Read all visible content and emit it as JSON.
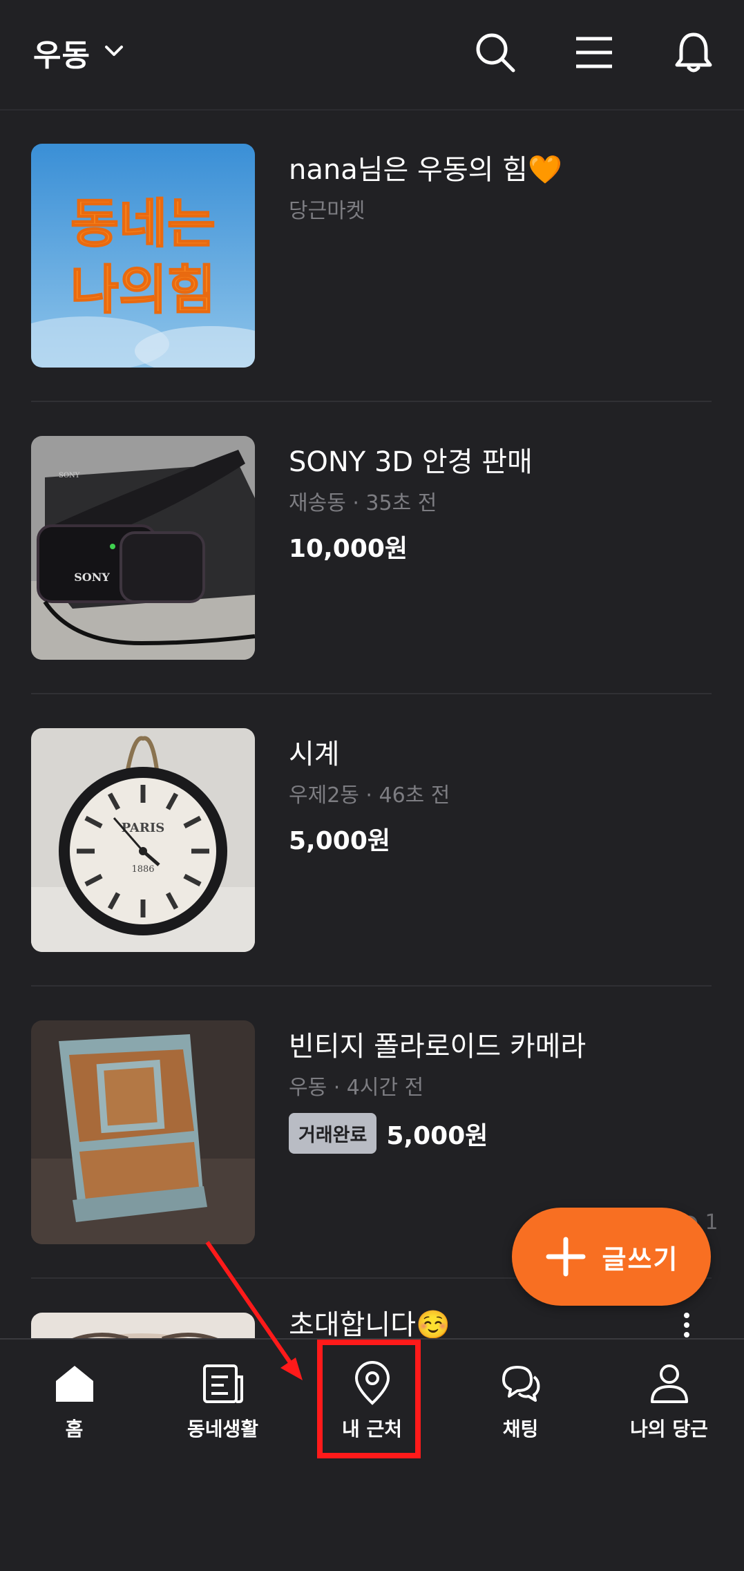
{
  "header": {
    "location_label": "우동",
    "icons": [
      "chevron-down-icon",
      "search-icon",
      "menu-icon",
      "bell-icon"
    ]
  },
  "items": [
    {
      "title": "nana님은 우동의 힘",
      "title_emoji": "🧡",
      "meta": "당근마켓",
      "price": "",
      "badge": "",
      "thumb_text_line1": "동네는",
      "thumb_text_line2": "나의힘"
    },
    {
      "title": "SONY 3D 안경 판매",
      "meta": "재송동 · 35초 전",
      "price": "10,000원",
      "badge": "",
      "thumb_brand_1": "SONY",
      "thumb_brand_2": "SONY"
    },
    {
      "title": "시계",
      "meta": "우제2동 · 46초 전",
      "price": "5,000원",
      "badge": "",
      "thumb_clock_text_1": "PARIS",
      "thumb_clock_text_2": "1886"
    },
    {
      "title": "빈티지 폴라로이드 카메라",
      "meta": "우동 · 4시간 전",
      "price": "5,000원",
      "badge": "거래완료",
      "comment_count": "1"
    },
    {
      "title": "초대합니다",
      "title_emoji": "☺️"
    }
  ],
  "fab": {
    "label": "글쓰기"
  },
  "nav": [
    {
      "label": "홈",
      "icon": "home-icon"
    },
    {
      "label": "동네생활",
      "icon": "newspaper-icon"
    },
    {
      "label": "내 근처",
      "icon": "location-pin-icon"
    },
    {
      "label": "채팅",
      "icon": "chat-icon"
    },
    {
      "label": "나의 당근",
      "icon": "person-icon"
    }
  ],
  "colors": {
    "background": "#212124",
    "accent": "#f86f22",
    "highlight": "#ff1a1a",
    "meta_text": "#7d7d82"
  }
}
